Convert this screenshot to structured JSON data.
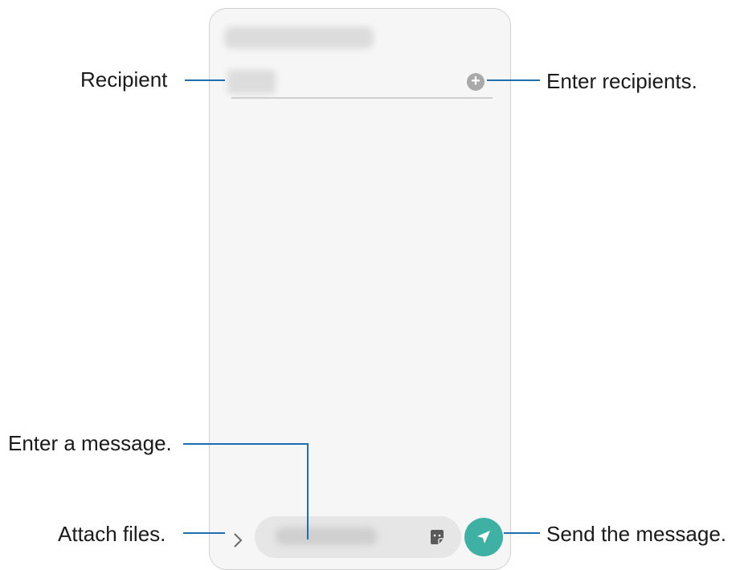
{
  "callouts": {
    "recipient": "Recipient",
    "enter_recipients": "Enter recipients.",
    "enter_message": "Enter a message.",
    "attach_files": "Attach files.",
    "send_message": "Send the message."
  },
  "phone_ui": {
    "add_recipient_symbol": "+",
    "icons": {
      "add": "plus-circle-icon",
      "attach": "chevron-right-icon",
      "sticker": "sticker-icon",
      "send": "paper-plane-icon"
    }
  },
  "colors": {
    "leader_line": "#1f6fb0",
    "send_button": "#3fb0a4"
  }
}
